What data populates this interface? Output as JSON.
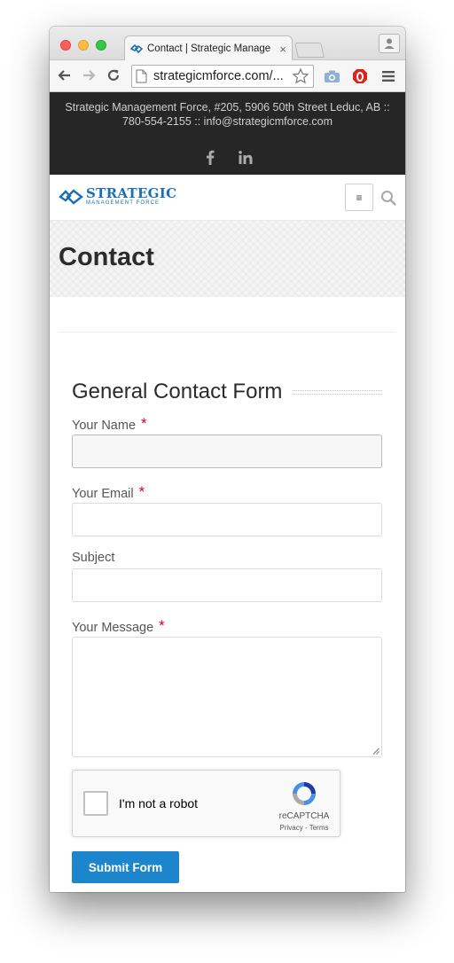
{
  "browser": {
    "tab_title": "Contact | Strategic Manage",
    "tab_close": "×",
    "url": "strategicmforce.com/...",
    "colors": {
      "close": "#fc605c",
      "minimize": "#fdbc40",
      "maximize": "#34c84a"
    }
  },
  "topbar": {
    "address": "Strategic Management Force, #205, 5906 50th Street Leduc, AB :: 780-554-2155 :: info@strategicmforce.com",
    "social_icons": [
      "facebook-icon",
      "linkedin-icon"
    ]
  },
  "header": {
    "logo_main": "STRATEGIC",
    "logo_sub": "MANAGEMENT FORCE",
    "menu_icon": "≡",
    "brand_color": "#1c6fb5"
  },
  "page": {
    "title": "Contact"
  },
  "form": {
    "heading": "General Contact Form",
    "required_mark": "*",
    "fields": [
      {
        "label": "Your Name",
        "required": true,
        "value": ""
      },
      {
        "label": "Your Email",
        "required": true,
        "value": ""
      },
      {
        "label": "Subject",
        "required": false,
        "value": ""
      },
      {
        "label": "Your Message",
        "required": true,
        "value": ""
      }
    ],
    "recaptcha": {
      "label": "I'm not a robot",
      "brand": "reCAPTCHA",
      "links": "Privacy - Terms"
    },
    "submit_label": "Submit Form",
    "submit_color": "#1c85cc"
  }
}
